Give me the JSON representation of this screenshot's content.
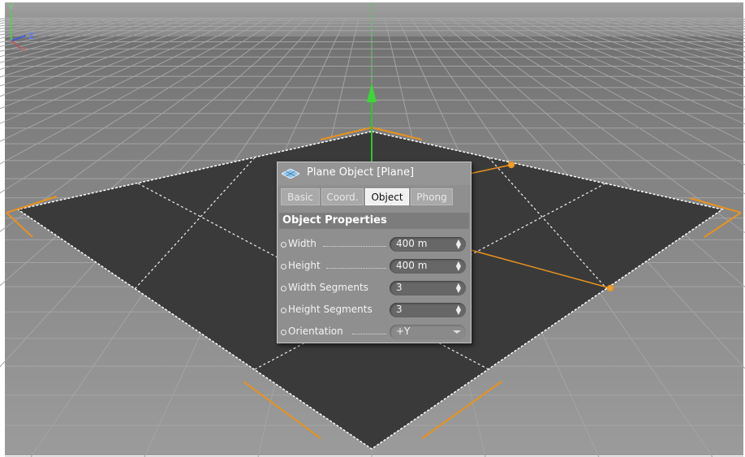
{
  "panel": {
    "title": "Plane Object [Plane]",
    "tabs": [
      {
        "label": "Basic",
        "active": false
      },
      {
        "label": "Coord.",
        "active": false
      },
      {
        "label": "Object",
        "active": true
      },
      {
        "label": "Phong",
        "active": false
      }
    ],
    "section_title": "Object Properties",
    "properties": [
      {
        "label": "Width",
        "value": "400 m",
        "control": "spinner"
      },
      {
        "label": "Height",
        "value": "400 m",
        "control": "spinner"
      },
      {
        "label": "Width Segments",
        "value": "3",
        "control": "spinner"
      },
      {
        "label": "Height Segments",
        "value": "3",
        "control": "spinner"
      },
      {
        "label": "Orientation",
        "value": "+Y",
        "control": "dropdown"
      }
    ]
  },
  "axis_gizmo": {
    "labels": [
      "Y",
      "Z",
      "X"
    ]
  },
  "colors": {
    "viewport_bg": "#898989",
    "floor_grid_line": "#a6a6a6",
    "plane_fill": "#3c3c3c",
    "selection_orange": "#e8921e",
    "y_axis_green": "#31c42f",
    "active_tab": "#f0f0f0"
  },
  "icons": {
    "panel_title": "plane-object-icon",
    "spinner": "spinner-arrows-icon",
    "dropdown": "chevron-down-icon"
  }
}
